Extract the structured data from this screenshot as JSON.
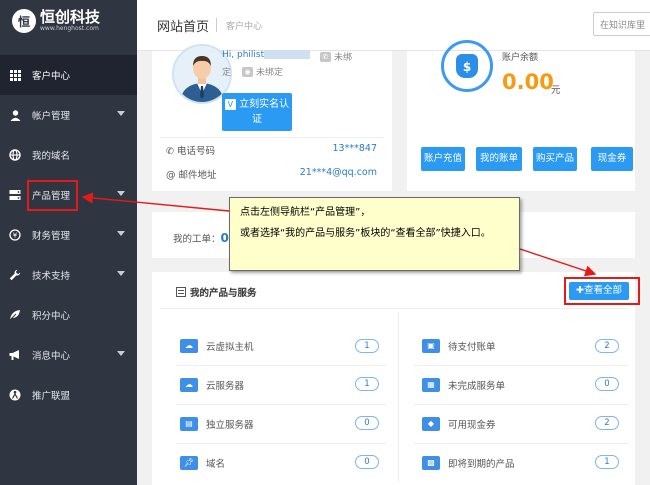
{
  "brand": {
    "name": "恒创科技",
    "domain": "www.henghost.com"
  },
  "sidebar": {
    "items": [
      {
        "label": "客户中心",
        "icon": "grid-icon",
        "active": true,
        "has_arrow": false
      },
      {
        "label": "帐户管理",
        "icon": "user-icon",
        "active": false,
        "has_arrow": true
      },
      {
        "label": "我的域名",
        "icon": "globe-icon",
        "active": false,
        "has_arrow": false
      },
      {
        "label": "产品管理",
        "icon": "server-icon",
        "active": false,
        "has_arrow": true
      },
      {
        "label": "财务管理",
        "icon": "yen-icon",
        "active": false,
        "has_arrow": true
      },
      {
        "label": "技术支持",
        "icon": "wrench-icon",
        "active": false,
        "has_arrow": true
      },
      {
        "label": "积分中心",
        "icon": "leaf-icon",
        "active": false,
        "has_arrow": false
      },
      {
        "label": "消息中心",
        "icon": "megaphone-icon",
        "active": false,
        "has_arrow": true
      },
      {
        "label": "推广联盟",
        "icon": "share-icon",
        "active": false,
        "has_arrow": false
      }
    ]
  },
  "header": {
    "title": "网站首页",
    "subtitle": "客户中心",
    "search_placeholder": "在知识库里"
  },
  "profile": {
    "greeting": "Hi,",
    "username": "philist",
    "phone_bind_status": "未绑",
    "wechat_bind_prefix": "定",
    "wechat_bind_status": "未绑定",
    "verify_button": "立刻实名认证",
    "phone_label": "电话号码",
    "phone_value": "13***847",
    "email_label": "邮件地址",
    "email_value": "21***4@qq.com"
  },
  "balance": {
    "label": "账户余额",
    "amount": "0.00",
    "unit": "元",
    "buttons": [
      "账户充值",
      "我的账单",
      "购买产品",
      "现金券"
    ]
  },
  "work_order": {
    "label": "我的工单：",
    "count": "0"
  },
  "products": {
    "title": "我的产品与服务",
    "view_all": "查看全部",
    "left": [
      {
        "label": "云虚拟主机",
        "count": "1",
        "icon": "cloud-icon"
      },
      {
        "label": "云服务器",
        "count": "1",
        "icon": "cloud-server-icon"
      },
      {
        "label": "独立服务器",
        "count": "0",
        "icon": "rack-icon"
      },
      {
        "label": "域名",
        "count": "0",
        "icon": "pin-icon"
      }
    ],
    "right": [
      {
        "label": "待支付账单",
        "count": "2",
        "icon": "bill-icon"
      },
      {
        "label": "未完成服务单",
        "count": "0",
        "icon": "document-icon"
      },
      {
        "label": "可用现金券",
        "count": "2",
        "icon": "tag-icon"
      },
      {
        "label": "即将到期的产品",
        "count": "1",
        "icon": "box-icon"
      }
    ]
  },
  "callout": {
    "line1": "点击左侧导航栏“产品管理”，",
    "line2": "或者选择“我的产品与服务”板块的“查看全部”快捷入口。"
  },
  "colors": {
    "sidebar_bg": "#2f3541",
    "accent": "#2b9af3",
    "highlight": "#e41a1a",
    "amount": "#f79a12"
  }
}
